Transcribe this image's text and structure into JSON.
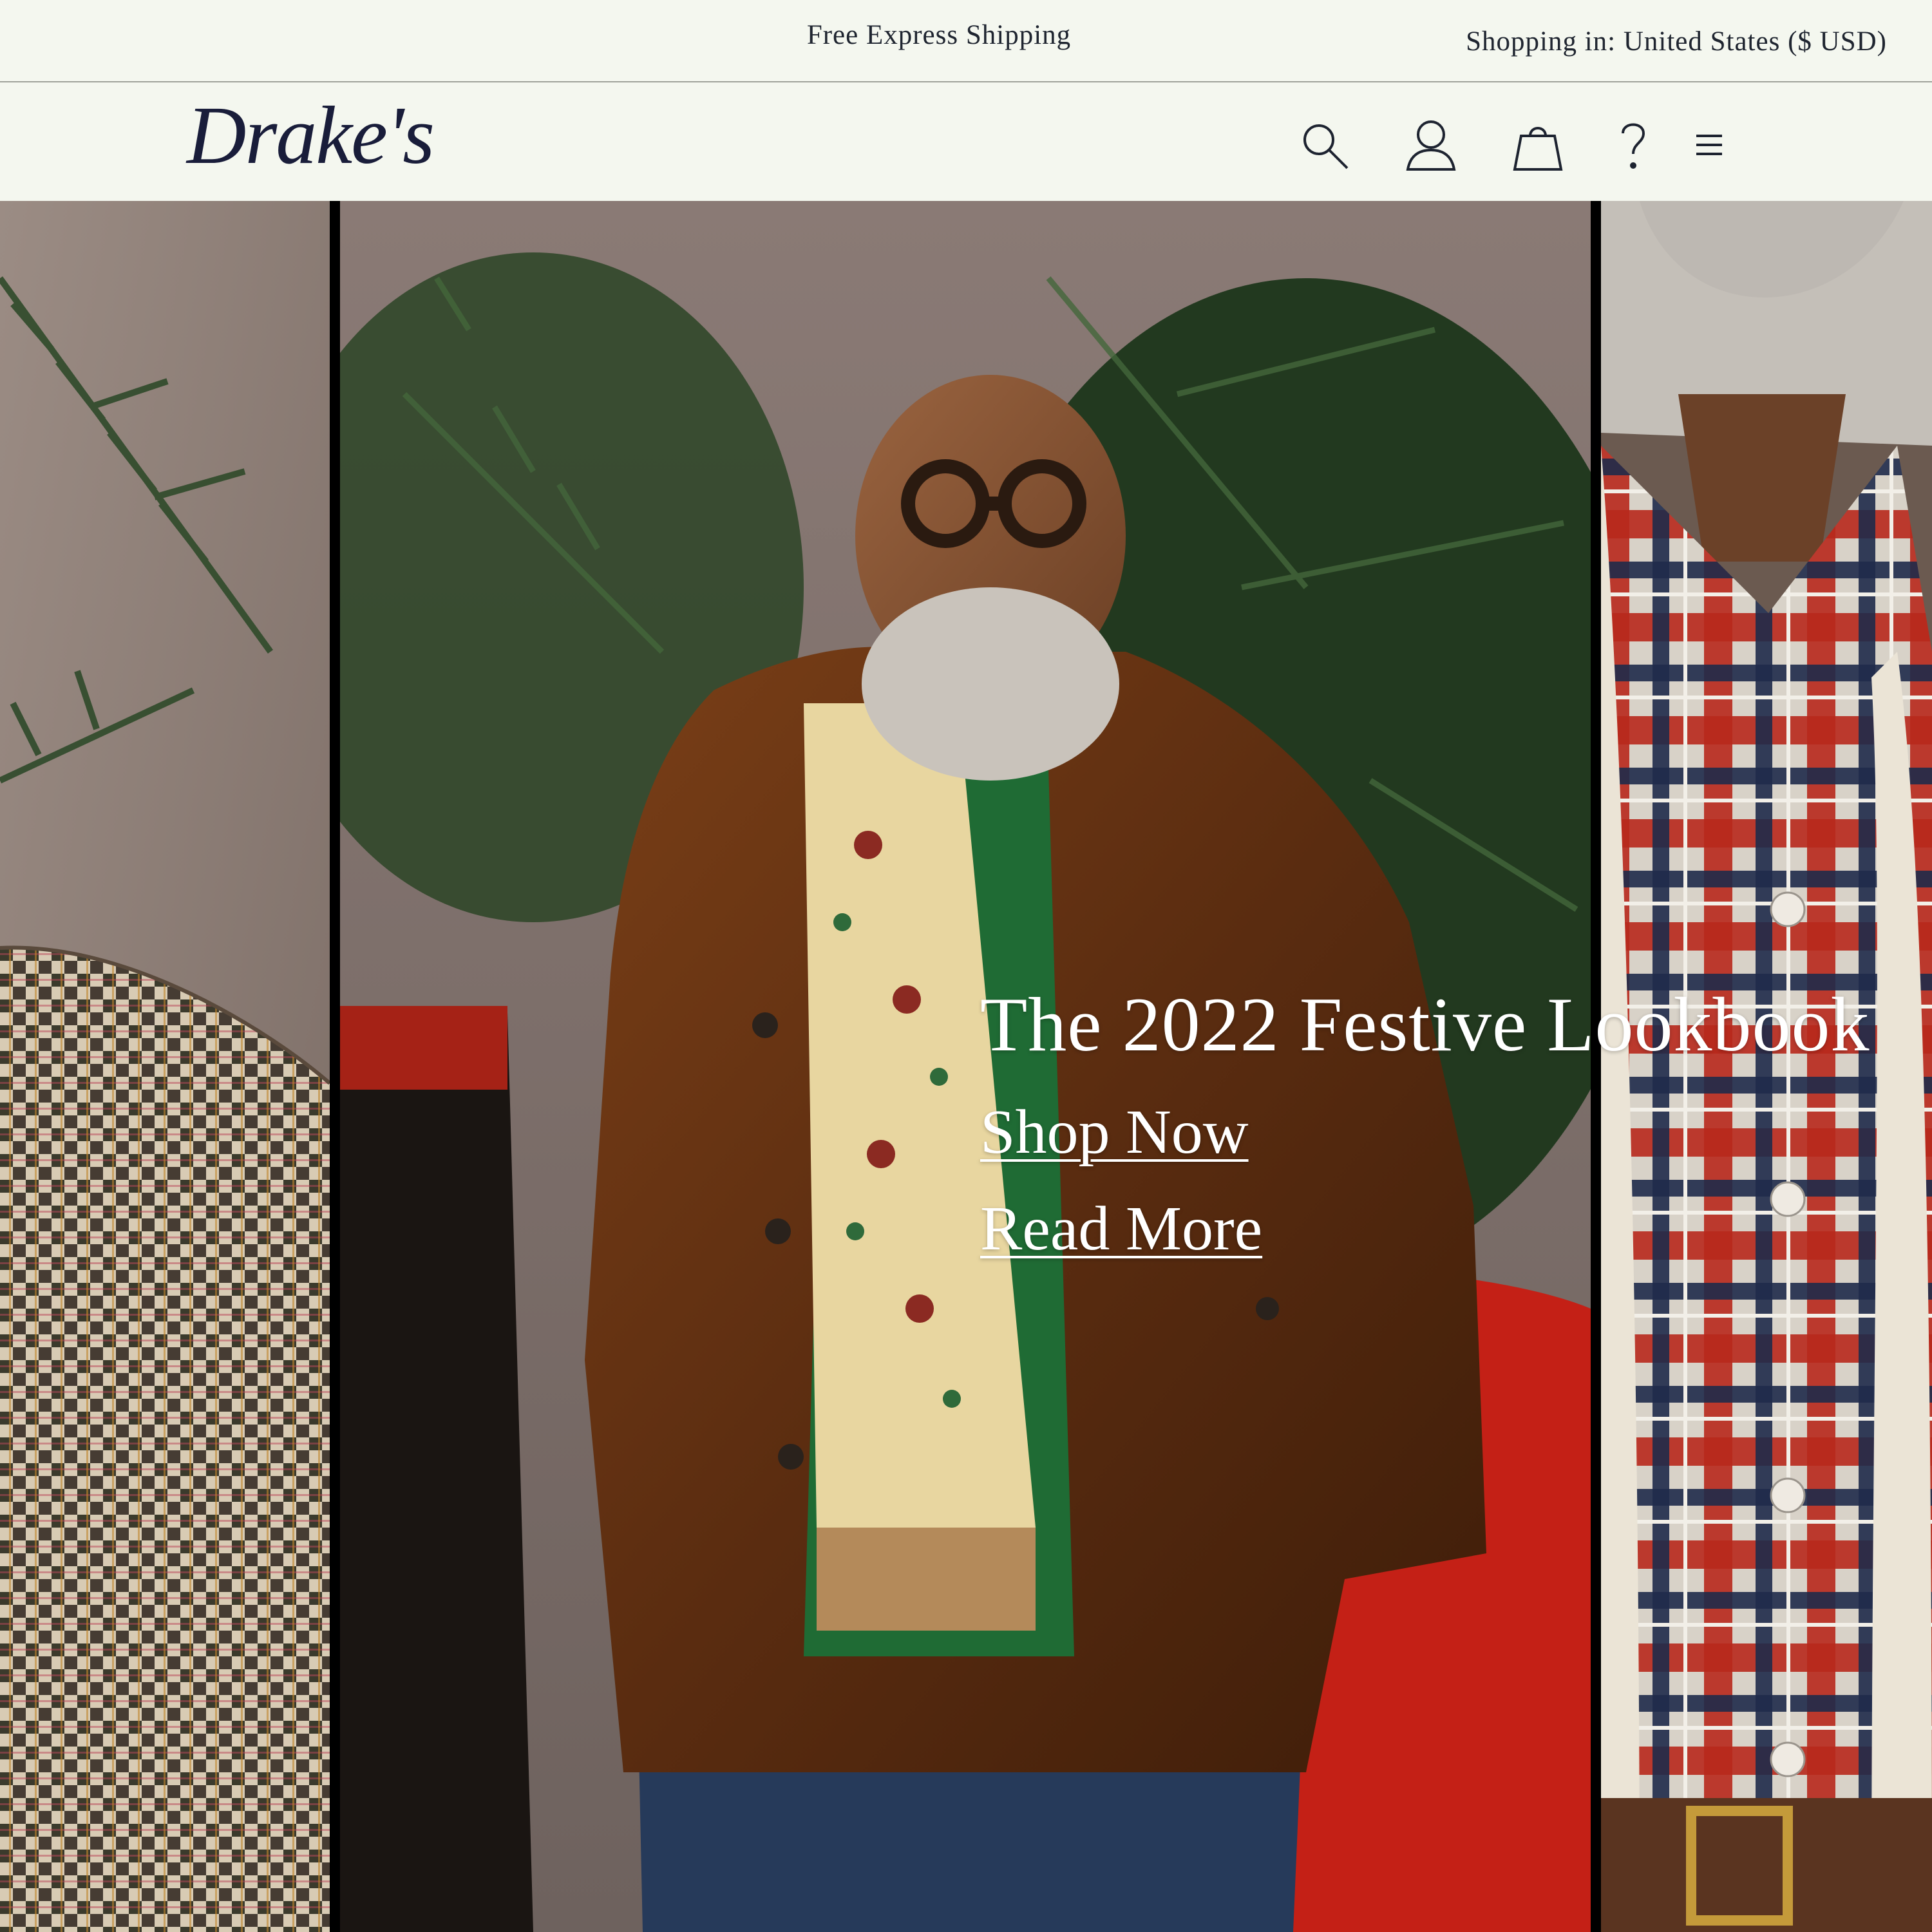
{
  "announcement": {
    "promo": "Free Express Shipping",
    "locale": "Shopping in: United States ($ USD)"
  },
  "header": {
    "logo": "Drake's",
    "icons": [
      "search-icon",
      "account-icon",
      "bag-icon",
      "help-icon",
      "menu-icon"
    ]
  },
  "hero": {
    "title": "The 2022 Festive Lookbook",
    "shop_link": "Shop Now",
    "read_link": "Read More"
  },
  "colors": {
    "background": "#f4f7ef",
    "text": "#1f2530",
    "logo": "#191d3a",
    "hero_text": "#ffffff"
  }
}
